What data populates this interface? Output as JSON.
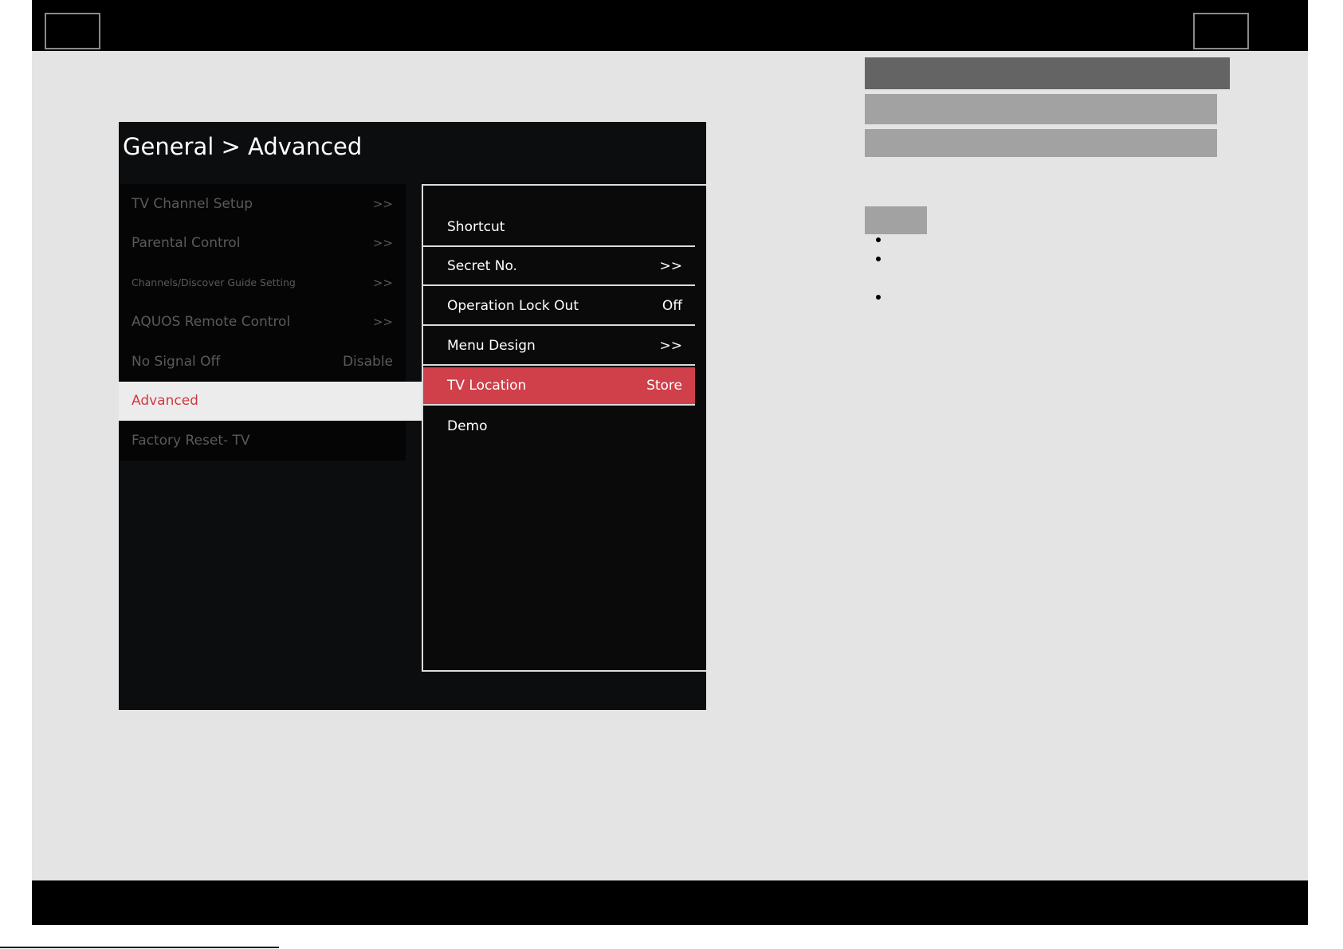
{
  "screen": {
    "title": "General > Advanced",
    "left_menu": [
      {
        "label": "TV Channel Setup",
        "value": ">>"
      },
      {
        "label": "Parental Control",
        "value": ">>"
      },
      {
        "label": "Channels/Discover Guide Setting",
        "value": ">>"
      },
      {
        "label": "AQUOS Remote Control",
        "value": ">>"
      },
      {
        "label": "No Signal Off",
        "value": "Disable"
      },
      {
        "label": "Advanced",
        "value": ""
      },
      {
        "label": "Factory Reset- TV",
        "value": ""
      }
    ],
    "right_menu": [
      {
        "label": "Shortcut",
        "value": ""
      },
      {
        "label": "Secret No.",
        "value": ">>"
      },
      {
        "label": "Operation Lock Out",
        "value": "Off"
      },
      {
        "label": "Menu Design",
        "value": ">>"
      },
      {
        "label": "TV Location",
        "value": "Store"
      },
      {
        "label": "Demo",
        "value": ""
      }
    ]
  },
  "colors": {
    "accent": "#d0404a",
    "active_text": "#d0393f",
    "panel_bg": "#0c0d0f",
    "page_bg": "#e4e4e4"
  }
}
